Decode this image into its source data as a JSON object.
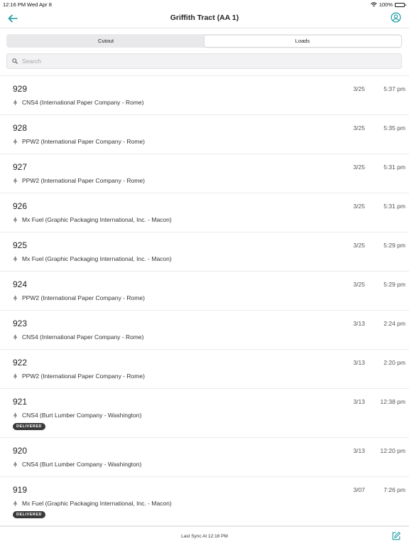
{
  "status_bar": {
    "time": "12:16 PM",
    "date": "Wed Apr 8",
    "battery": "100%"
  },
  "nav": {
    "title": "Griffith Tract (AA 1)",
    "back_icon": "back-arrow-icon",
    "account_icon": "account-icon"
  },
  "tabs": [
    {
      "label": "Cutout",
      "active": false
    },
    {
      "label": "Loads",
      "active": true
    }
  ],
  "search": {
    "placeholder": "Search",
    "value": ""
  },
  "loads": [
    {
      "number": "929",
      "date": "3/25",
      "time": "5:37 pm",
      "product": "CNS4 (International Paper Company - Rome)",
      "badge": ""
    },
    {
      "number": "928",
      "date": "3/25",
      "time": "5:35 pm",
      "product": "PPW2 (International Paper Company - Rome)",
      "badge": ""
    },
    {
      "number": "927",
      "date": "3/25",
      "time": "5:31 pm",
      "product": "PPW2 (International Paper Company - Rome)",
      "badge": ""
    },
    {
      "number": "926",
      "date": "3/25",
      "time": "5:31 pm",
      "product": "Mx Fuel (Graphic Packaging International, Inc. - Macon)",
      "badge": ""
    },
    {
      "number": "925",
      "date": "3/25",
      "time": "5:29 pm",
      "product": "Mx Fuel (Graphic Packaging International, Inc. - Macon)",
      "badge": ""
    },
    {
      "number": "924",
      "date": "3/25",
      "time": "5:29 pm",
      "product": "PPW2 (International Paper Company - Rome)",
      "badge": ""
    },
    {
      "number": "923",
      "date": "3/13",
      "time": "2:24 pm",
      "product": "CNS4 (International Paper Company - Rome)",
      "badge": ""
    },
    {
      "number": "922",
      "date": "3/13",
      "time": "2:20 pm",
      "product": "PPW2 (International Paper Company - Rome)",
      "badge": ""
    },
    {
      "number": "921",
      "date": "3/13",
      "time": "12:38 pm",
      "product": "CNS4 (Burt Lumber Company - Washington)",
      "badge": "DELIVERED"
    },
    {
      "number": "920",
      "date": "3/13",
      "time": "12:20 pm",
      "product": "CNS4 (Burt Lumber Company - Washington)",
      "badge": ""
    },
    {
      "number": "919",
      "date": "3/07",
      "time": "7:26 pm",
      "product": "Mx Fuel (Graphic Packaging International, Inc. - Macon)",
      "badge": "DELIVERED"
    }
  ],
  "footer": {
    "sync_text": "Last Sync At 12:16 PM",
    "edit_icon": "compose-icon"
  },
  "colors": {
    "accent": "#1a9aa0",
    "badge_bg": "#3a3a3a",
    "segment_bg": "#e9e9eb"
  }
}
